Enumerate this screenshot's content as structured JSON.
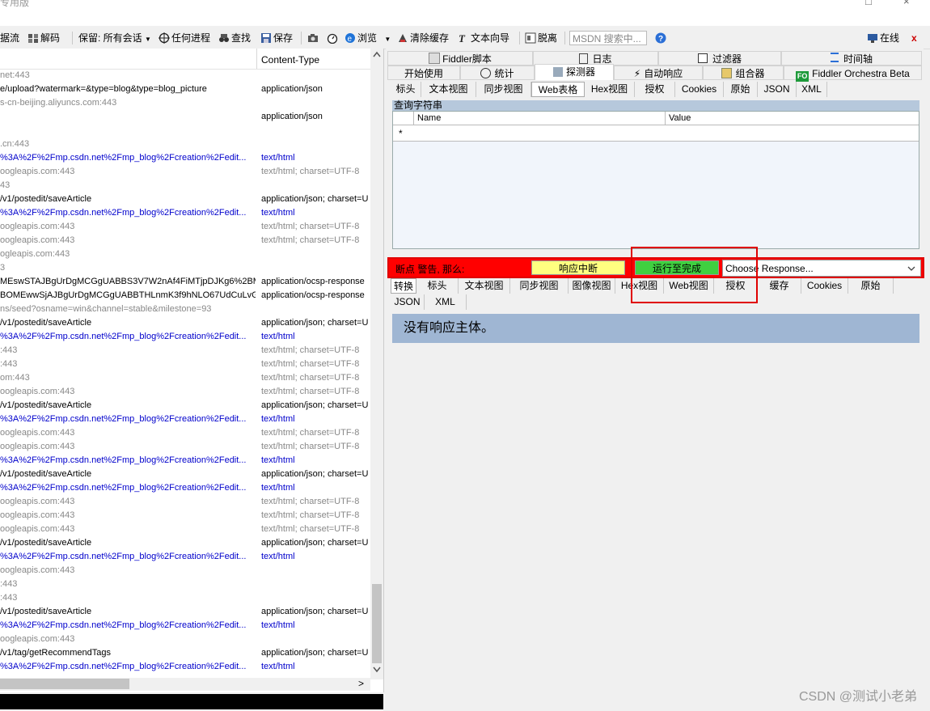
{
  "window": {
    "title_partial": "专用版",
    "min_glyph": "□",
    "close_glyph": "×"
  },
  "toolbar": {
    "items": [
      {
        "label": "据流",
        "icon": "stream-icon"
      },
      {
        "label": "解码",
        "icon": "decode-icon"
      },
      {
        "label": "保留: 所有会话",
        "icon": "dropdown-arrow-icon"
      },
      {
        "label": "任何进程",
        "icon": "crosshair-icon"
      },
      {
        "label": "查找",
        "icon": "binoculars-icon"
      },
      {
        "label": "保存",
        "icon": "save-icon"
      },
      {
        "label": "",
        "icon": "camera-icon"
      },
      {
        "label": "",
        "icon": "timer-icon"
      },
      {
        "label": "浏览",
        "icon": "ie-icon"
      },
      {
        "label": "清除缓存",
        "icon": "clear-cache-icon"
      },
      {
        "label": "文本向导",
        "icon": "text-wizard-icon"
      },
      {
        "label": "脱离",
        "icon": "tearoff-icon"
      }
    ],
    "search_placeholder": "MSDN 搜索中...",
    "online_label": "在线",
    "close_label": "x"
  },
  "sessions": {
    "content_type_header": "Content-Type",
    "rows": [
      {
        "url": "net:443",
        "ct": "",
        "kind": "gray"
      },
      {
        "url": "e/upload?watermark=&type=blog&type=blog_picture",
        "ct": "application/json",
        "kind": "dark"
      },
      {
        "url": "s-cn-beijing.aliyuncs.com:443",
        "ct": "",
        "kind": "gray"
      },
      {
        "url": "",
        "ct": "application/json",
        "kind": "dark"
      },
      {
        "url": "",
        "ct": "",
        "kind": "gray"
      },
      {
        "url": ".cn:443",
        "ct": "",
        "kind": "gray"
      },
      {
        "url": "%3A%2F%2Fmp.csdn.net%2Fmp_blog%2Fcreation%2Fedit...",
        "ct": "text/html",
        "kind": "blue"
      },
      {
        "url": "oogleapis.com:443",
        "ct": "text/html; charset=UTF-8",
        "kind": "gray"
      },
      {
        "url": "43",
        "ct": "",
        "kind": "gray"
      },
      {
        "url": "/v1/postedit/saveArticle",
        "ct": "application/json; charset=U",
        "kind": "dark"
      },
      {
        "url": "%3A%2F%2Fmp.csdn.net%2Fmp_blog%2Fcreation%2Fedit...",
        "ct": "text/html",
        "kind": "blue"
      },
      {
        "url": "oogleapis.com:443",
        "ct": "text/html; charset=UTF-8",
        "kind": "gray"
      },
      {
        "url": "oogleapis.com:443",
        "ct": "text/html; charset=UTF-8",
        "kind": "gray"
      },
      {
        "url": "ogleapis.com:443",
        "ct": "",
        "kind": "gray"
      },
      {
        "url": "3",
        "ct": "",
        "kind": "gray"
      },
      {
        "url": "MEswSTAJBgUrDgMCGgUABBS3V7W2nAf4FiMTjpDJKg6%2BMg...",
        "ct": "application/ocsp-response",
        "kind": "dark"
      },
      {
        "url": "BOMEwwSjAJBgUrDgMCGgUABBTHLnmK3f9hNLO67UdCuLvGW...",
        "ct": "application/ocsp-response",
        "kind": "dark"
      },
      {
        "url": "ns/seed?osname=win&channel=stable&milestone=93",
        "ct": "",
        "kind": "gray"
      },
      {
        "url": "/v1/postedit/saveArticle",
        "ct": "application/json; charset=U",
        "kind": "dark"
      },
      {
        "url": "%3A%2F%2Fmp.csdn.net%2Fmp_blog%2Fcreation%2Fedit...",
        "ct": "text/html",
        "kind": "blue"
      },
      {
        "url": ":443",
        "ct": "text/html; charset=UTF-8",
        "kind": "gray"
      },
      {
        "url": ":443",
        "ct": "text/html; charset=UTF-8",
        "kind": "gray"
      },
      {
        "url": "om:443",
        "ct": "text/html; charset=UTF-8",
        "kind": "gray"
      },
      {
        "url": "oogleapis.com:443",
        "ct": "text/html; charset=UTF-8",
        "kind": "gray"
      },
      {
        "url": "/v1/postedit/saveArticle",
        "ct": "application/json; charset=U",
        "kind": "dark"
      },
      {
        "url": "%3A%2F%2Fmp.csdn.net%2Fmp_blog%2Fcreation%2Fedit...",
        "ct": "text/html",
        "kind": "blue"
      },
      {
        "url": "oogleapis.com:443",
        "ct": "text/html; charset=UTF-8",
        "kind": "gray"
      },
      {
        "url": "oogleapis.com:443",
        "ct": "text/html; charset=UTF-8",
        "kind": "gray"
      },
      {
        "url": "%3A%2F%2Fmp.csdn.net%2Fmp_blog%2Fcreation%2Fedit...",
        "ct": "text/html",
        "kind": "blue"
      },
      {
        "url": "/v1/postedit/saveArticle",
        "ct": "application/json; charset=U",
        "kind": "dark"
      },
      {
        "url": "%3A%2F%2Fmp.csdn.net%2Fmp_blog%2Fcreation%2Fedit...",
        "ct": "text/html",
        "kind": "blue"
      },
      {
        "url": "oogleapis.com:443",
        "ct": "text/html; charset=UTF-8",
        "kind": "gray"
      },
      {
        "url": "oogleapis.com:443",
        "ct": "text/html; charset=UTF-8",
        "kind": "gray"
      },
      {
        "url": "oogleapis.com:443",
        "ct": "text/html; charset=UTF-8",
        "kind": "gray"
      },
      {
        "url": "/v1/postedit/saveArticle",
        "ct": "application/json; charset=U",
        "kind": "dark"
      },
      {
        "url": "%3A%2F%2Fmp.csdn.net%2Fmp_blog%2Fcreation%2Fedit...",
        "ct": "text/html",
        "kind": "blue"
      },
      {
        "url": "oogleapis.com:443",
        "ct": "",
        "kind": "gray"
      },
      {
        "url": ":443",
        "ct": "",
        "kind": "gray"
      },
      {
        "url": ":443",
        "ct": "",
        "kind": "gray"
      },
      {
        "url": "/v1/postedit/saveArticle",
        "ct": "application/json; charset=U",
        "kind": "dark"
      },
      {
        "url": "%3A%2F%2Fmp.csdn.net%2Fmp_blog%2Fcreation%2Fedit...",
        "ct": "text/html",
        "kind": "blue"
      },
      {
        "url": "oogleapis.com:443",
        "ct": "",
        "kind": "gray"
      },
      {
        "url": "/v1/tag/getRecommendTags",
        "ct": "application/json; charset=U",
        "kind": "dark"
      },
      {
        "url": "%3A%2F%2Fmp.csdn.net%2Fmp_blog%2Fcreation%2Fedit...",
        "ct": "text/html",
        "kind": "blue"
      }
    ],
    "hscroll_arrow": ">"
  },
  "tabs_row1": [
    "Fiddler脚本",
    "日志",
    "过滤器",
    "时间轴"
  ],
  "tabs_row2": [
    "开始使用",
    "统计",
    "探测器",
    "自动响应",
    "组合器",
    "Fiddler Orchestra Beta"
  ],
  "request_subtabs": [
    "标头",
    "文本视图",
    "同步视图",
    "Web表格",
    "Hex视图",
    "授权",
    "Cookies",
    "原始",
    "JSON",
    "XML"
  ],
  "query_section": {
    "title": "查询字符串",
    "col_name": "Name",
    "col_value": "Value",
    "new_row_marker": "*"
  },
  "breakpoint_bar": {
    "label": "断点 警告, 那么:",
    "break_on_response": "响应中断",
    "run_to_completion": "运行至完成",
    "choose_response": "Choose Response...",
    "colors": {
      "bar": "#ff0000",
      "break": "#ffff80",
      "run": "#40d040"
    }
  },
  "response_subtabs_row1": [
    "转换",
    "标头",
    "文本视图",
    "同步视图",
    "图像视图",
    "Hex视图",
    "Web视图",
    "授权",
    "缓存",
    "Cookies",
    "原始"
  ],
  "response_subtabs_row2": [
    "JSON",
    "XML"
  ],
  "response_body": "没有响应主体。",
  "watermark": "CSDN @测试小老弟"
}
